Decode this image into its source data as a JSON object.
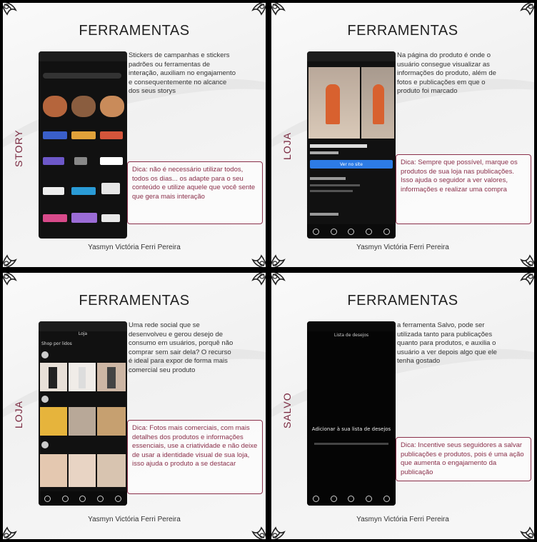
{
  "panels": [
    {
      "title": "FERRAMENTAS",
      "label": "STORY",
      "description": "Stickers de campanhas e stickers padrões ou ferramentas de interação, auxiliam no engajamento e consequentemente no alcance dos seus storys",
      "tip": "Dica: não é necessário utilizar todos, todos os dias... os adapte para o seu conteúdo e utilize aquele que você sente que gera mais interação",
      "author": "Yasmyn Victória Ferri Pereira"
    },
    {
      "title": "FERRAMENTAS",
      "label": "LOJA",
      "description": "Na página do produto é onde o usuário consegue visualizar as informações do produto, além de fotos e publicações em que o produto foi marcado",
      "tip": "Dica: Sempre que possível, marque os produtos de sua loja nas publicações. Isso ajuda o seguidor a ver valores, informações e realizar uma compra",
      "author": "Yasmyn Victória Ferri Pereira"
    },
    {
      "title": "FERRAMENTAS",
      "label": "LOJA",
      "description": "Uma rede social que se desenvolveu e gerou desejo de consumo em usuários, porquê não comprar sem sair dela? O recurso é ideal para expor de forma mais comercial seu produto",
      "tip": "Dica: Fotos mais comerciais, com mais detalhes dos produtos e informações essenciais, use a criatividade e não deixe de usar a identidade visual de sua loja, isso ajuda o produto a se destacar",
      "author": "Yasmyn Victória Ferri Pereira"
    },
    {
      "title": "FERRAMENTAS",
      "label": "SALVO",
      "description": "a ferramenta Salvo, pode ser utilizada tanto para publicações quanto para produtos, e auxilia o usuário a ver depois algo que ele tenha gostado",
      "tip": "Dica: Incentive seus seguidores a salvar publicações e produtos, pois é uma ação que aumenta o engajamento da publicação",
      "author": "Yasmyn Victória Ferri Pereira"
    }
  ],
  "phone_texts": {
    "shop_header": "Loja",
    "shop_section": "Shop por lidos",
    "wishlist_title": "Lista de desejos",
    "wishlist_empty": "Adicionar à sua lista de desejos",
    "product_button": "Ver no site"
  },
  "colors": {
    "accent": "#8a2f4a",
    "frame": "#000000",
    "panel_bg": "#f5f5f5"
  },
  "icons": [
    "mandala-corner-icon",
    "home-icon",
    "search-icon",
    "shop-icon",
    "profile-icon"
  ]
}
